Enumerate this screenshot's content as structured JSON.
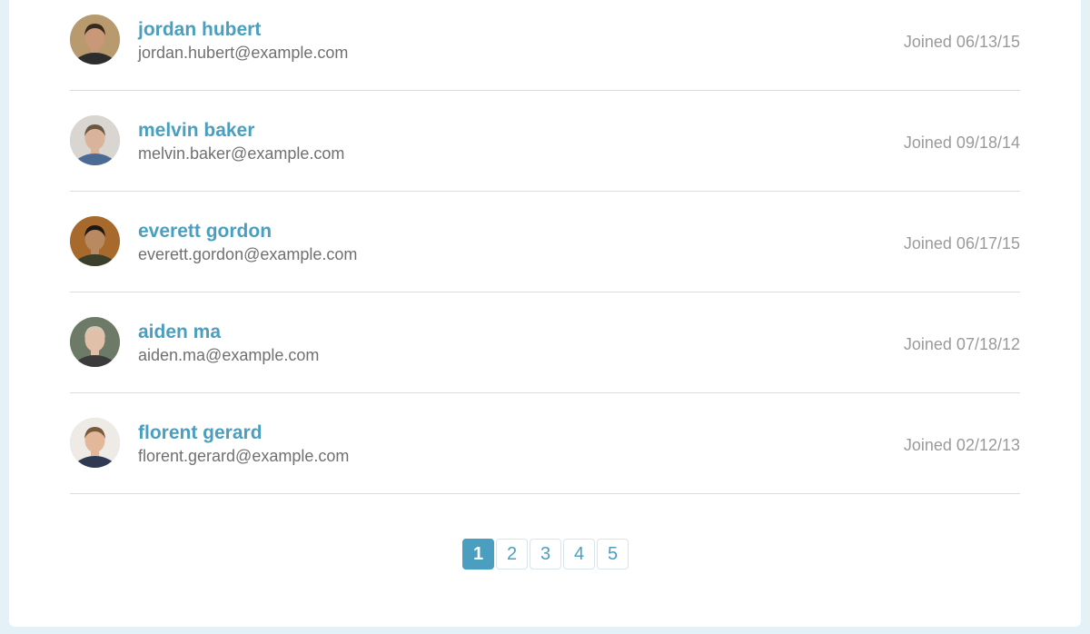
{
  "users": [
    {
      "name": "jordan hubert",
      "email": "jordan.hubert@example.com",
      "joined": "Joined 06/13/15",
      "avatar_colors": {
        "bg": "#b89a6e",
        "skin": "#c99878",
        "hair": "#3a2a1e",
        "shirt": "#2d2d2d"
      }
    },
    {
      "name": "melvin baker",
      "email": "melvin.baker@example.com",
      "joined": "Joined 09/18/14",
      "avatar_colors": {
        "bg": "#d9d6d2",
        "skin": "#d9b49a",
        "hair": "#6b5844",
        "shirt": "#4b6a94"
      }
    },
    {
      "name": "everett gordon",
      "email": "everett.gordon@example.com",
      "joined": "Joined 06/17/15",
      "avatar_colors": {
        "bg": "#a86a2c",
        "skin": "#b98a62",
        "hair": "#1e1712",
        "shirt": "#3a3f2c"
      }
    },
    {
      "name": "aiden ma",
      "email": "aiden.ma@example.com",
      "joined": "Joined 07/18/12",
      "avatar_colors": {
        "bg": "#6d7a68",
        "skin": "#e0c0a8",
        "hair": "#d8c6b2",
        "shirt": "#3b3b3b"
      }
    },
    {
      "name": "florent gerard",
      "email": "florent.gerard@example.com",
      "joined": "Joined 02/12/13",
      "avatar_colors": {
        "bg": "#eeeae6",
        "skin": "#e3b89a",
        "hair": "#7a5a3c",
        "shirt": "#2e3a52"
      }
    }
  ],
  "pagination": {
    "pages": [
      "1",
      "2",
      "3",
      "4",
      "5"
    ],
    "current": "1"
  },
  "colors": {
    "accent": "#4a9fc0",
    "page_background": "#e4f1f7"
  }
}
